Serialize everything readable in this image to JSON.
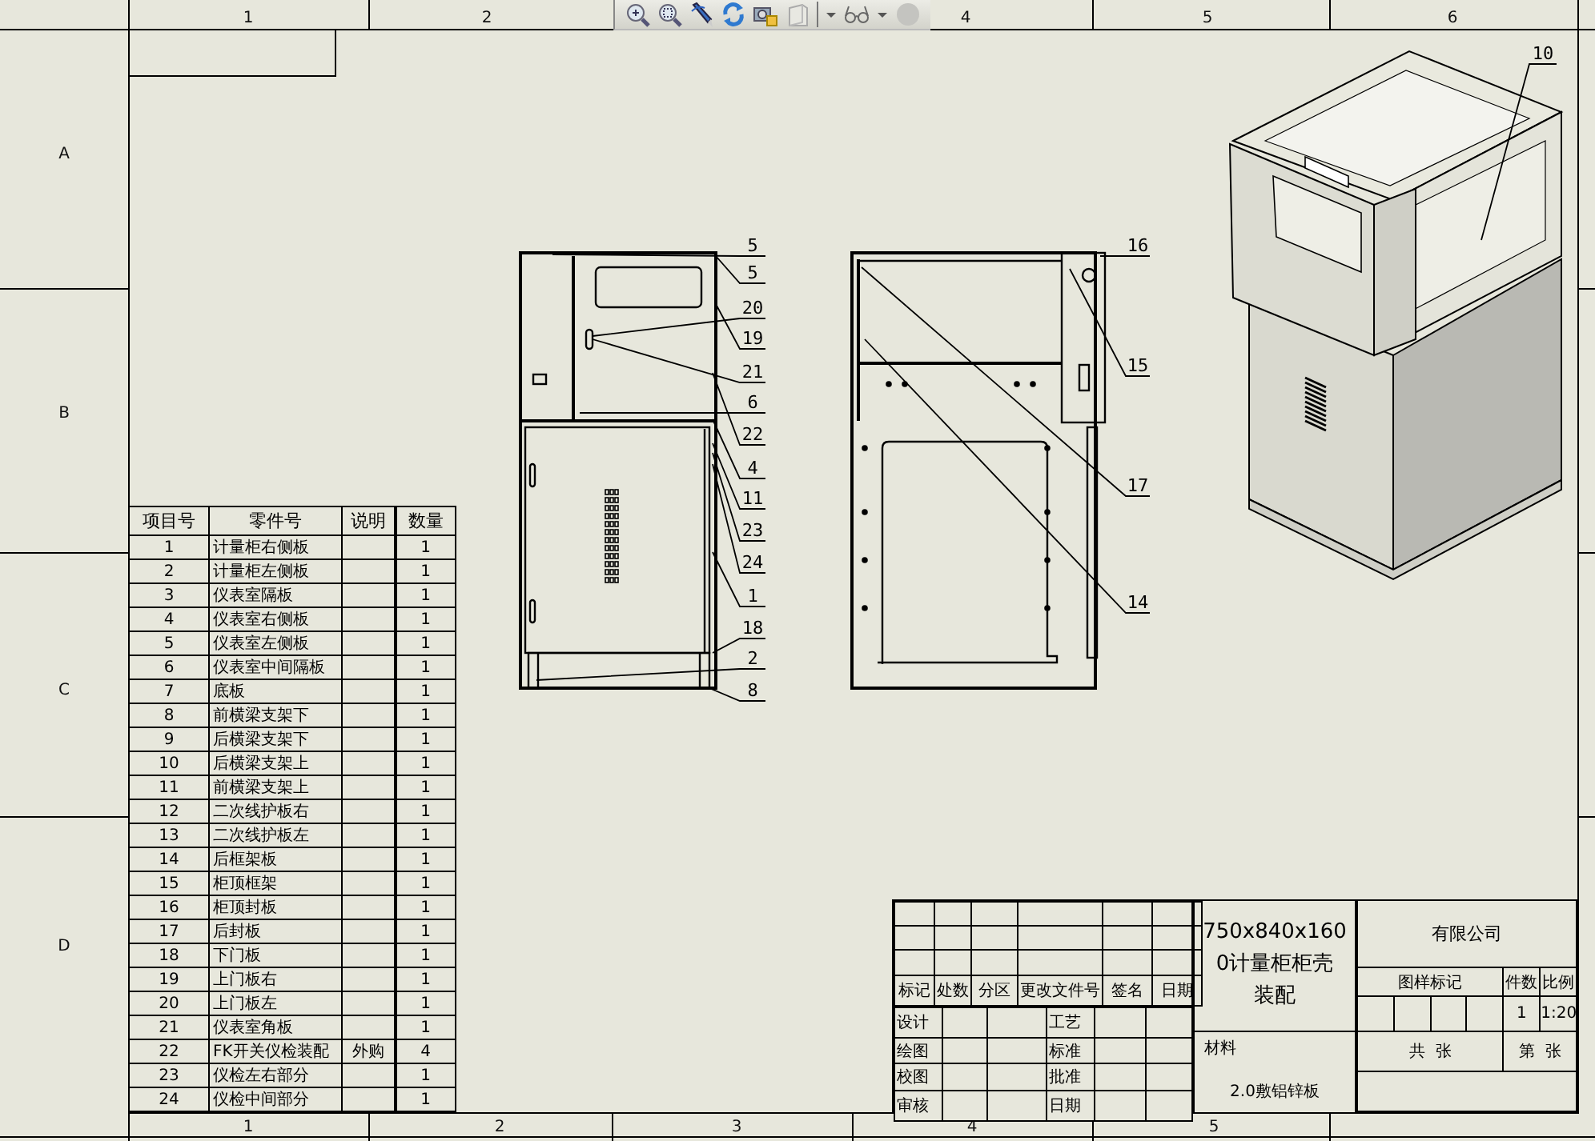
{
  "sheet": {
    "top_zones": [
      "1",
      "2",
      "4",
      "5",
      "6"
    ],
    "bottom_zones": [
      "1",
      "2",
      "3",
      "4",
      "5"
    ],
    "left_zones": [
      "A",
      "B",
      "C",
      "D"
    ]
  },
  "front_view": {
    "balloons": [
      "5",
      "5",
      "20",
      "19",
      "21",
      "6",
      "22",
      "4",
      "11",
      "23",
      "24",
      "1",
      "18",
      "2",
      "8"
    ]
  },
  "rear_view": {
    "balloons": [
      "16",
      "15",
      "17",
      "14"
    ]
  },
  "iso_view": {
    "balloons": [
      "10"
    ]
  },
  "bom": {
    "columns": [
      "项目号",
      "零件号",
      "说明",
      "数量"
    ],
    "rows": [
      {
        "item": "1",
        "name": "计量柜右侧板",
        "note": "",
        "qty": "1"
      },
      {
        "item": "2",
        "name": "计量柜左侧板",
        "note": "",
        "qty": "1"
      },
      {
        "item": "3",
        "name": "仪表室隔板",
        "note": "",
        "qty": "1"
      },
      {
        "item": "4",
        "name": "仪表室右侧板",
        "note": "",
        "qty": "1"
      },
      {
        "item": "5",
        "name": "仪表室左侧板",
        "note": "",
        "qty": "1"
      },
      {
        "item": "6",
        "name": "仪表室中间隔板",
        "note": "",
        "qty": "1"
      },
      {
        "item": "7",
        "name": "底板",
        "note": "",
        "qty": "1"
      },
      {
        "item": "8",
        "name": "前横梁支架下",
        "note": "",
        "qty": "1"
      },
      {
        "item": "9",
        "name": "后横梁支架下",
        "note": "",
        "qty": "1"
      },
      {
        "item": "10",
        "name": "后横梁支架上",
        "note": "",
        "qty": "1"
      },
      {
        "item": "11",
        "name": "前横梁支架上",
        "note": "",
        "qty": "1"
      },
      {
        "item": "12",
        "name": "二次线护板右",
        "note": "",
        "qty": "1"
      },
      {
        "item": "13",
        "name": "二次线护板左",
        "note": "",
        "qty": "1"
      },
      {
        "item": "14",
        "name": "后框架板",
        "note": "",
        "qty": "1"
      },
      {
        "item": "15",
        "name": "柜顶框架",
        "note": "",
        "qty": "1"
      },
      {
        "item": "16",
        "name": "柜顶封板",
        "note": "",
        "qty": "1"
      },
      {
        "item": "17",
        "name": "后封板",
        "note": "",
        "qty": "1"
      },
      {
        "item": "18",
        "name": "下门板",
        "note": "",
        "qty": "1"
      },
      {
        "item": "19",
        "name": "上门板右",
        "note": "",
        "qty": "1"
      },
      {
        "item": "20",
        "name": "上门板左",
        "note": "",
        "qty": "1"
      },
      {
        "item": "21",
        "name": "仪表室角板",
        "note": "",
        "qty": "1"
      },
      {
        "item": "22",
        "name": "FK开关仪检装配",
        "note": "外购",
        "qty": "4"
      },
      {
        "item": "23",
        "name": "仪检左右部分",
        "note": "",
        "qty": "1"
      },
      {
        "item": "24",
        "name": "仪检中间部分",
        "note": "",
        "qty": "1"
      }
    ]
  },
  "title_block": {
    "revision_headers": [
      "标记",
      "处数",
      "分区",
      "更改文件号",
      "签名",
      "日期"
    ],
    "sign_rows": [
      {
        "left": "设计",
        "right": "工艺"
      },
      {
        "left": "绘图",
        "right": "标准"
      },
      {
        "left": "校图",
        "right": "批准"
      },
      {
        "left": "审核",
        "right": "日期"
      }
    ],
    "title_lines": [
      "750x840x160",
      "0计量柜柜壳",
      "装配"
    ],
    "material_label": "材料",
    "material": "2.0敷铝锌板",
    "company": "有限公司",
    "mark_label": "图样标记",
    "count_label": "件数",
    "scale_label": "比例",
    "count": "1",
    "scale": "1:20",
    "sheets_total": "共  张",
    "sheet_no": "第  张"
  }
}
